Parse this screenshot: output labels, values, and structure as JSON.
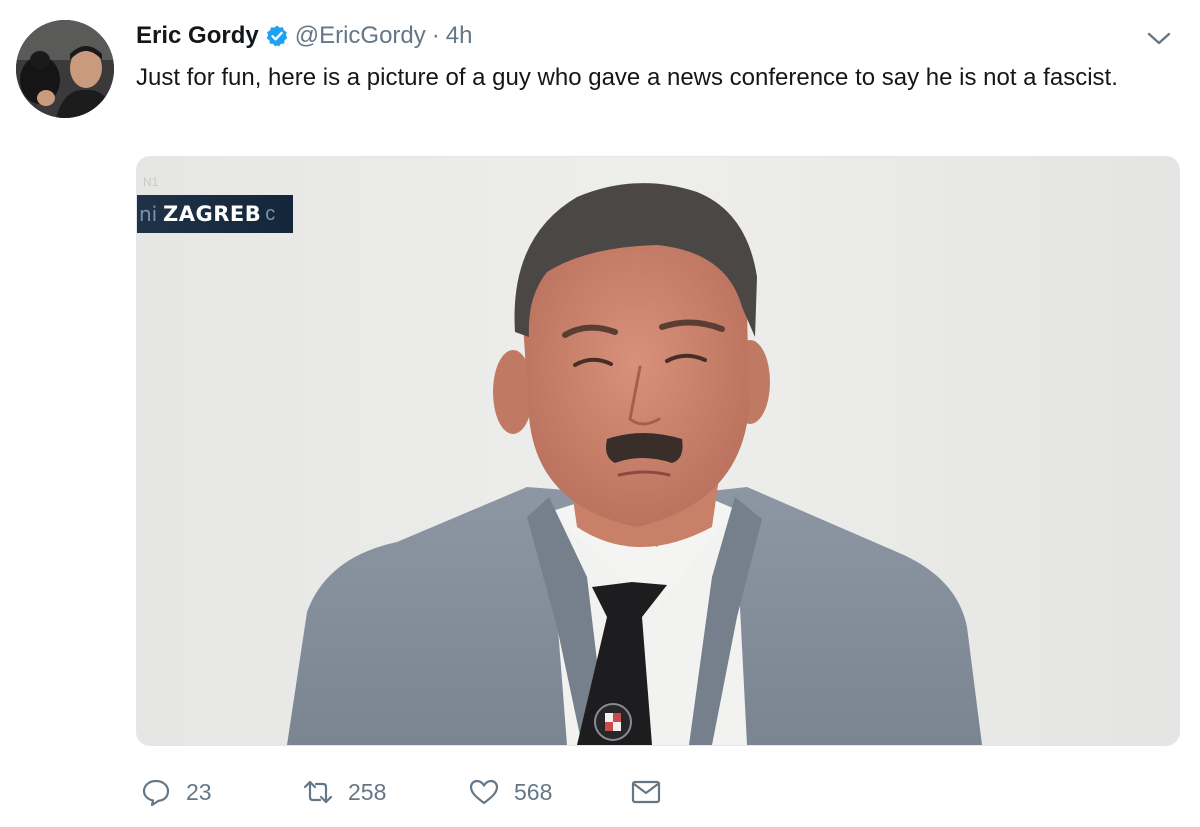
{
  "tweet": {
    "author_name": "Eric Gordy",
    "handle": "@EricGordy",
    "separator": "·",
    "time": "4h",
    "text": "Just for fun, here is a picture of a guy who gave a news conference to say he is not a fascist."
  },
  "media": {
    "location_tag": "ZAGREB",
    "location_tag_ghost_left": "ni",
    "location_tag_ghost_right": "c"
  },
  "actions": {
    "reply_count": "23",
    "retweet_count": "258",
    "like_count": "568"
  },
  "icons": {
    "verified": "verified-badge-icon",
    "caret": "chevron-down-icon",
    "reply": "reply-icon",
    "retweet": "retweet-icon",
    "like": "heart-icon",
    "dm": "envelope-icon"
  },
  "colors": {
    "verified_blue": "#1da1f2",
    "secondary_text": "#657786",
    "primary_text": "#14171a",
    "location_tag_bg": "#1f3247"
  }
}
